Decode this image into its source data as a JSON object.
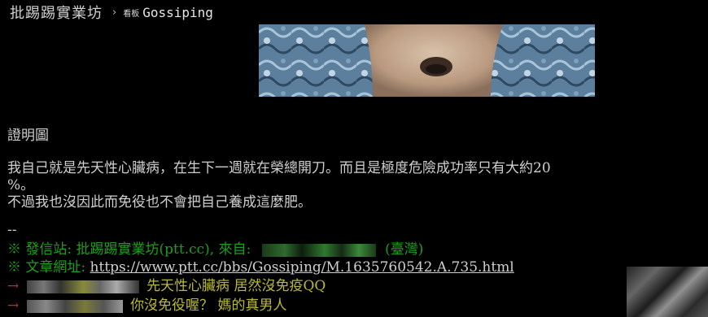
{
  "header": {
    "site_title": "批踢踢實業坊",
    "separator": "›",
    "board_prefix": "看板",
    "board_name": "Gossiping"
  },
  "body": {
    "line1": "證明圖",
    "line2": "我自己就是先天性心臟病，在生下一週就在榮總開刀。而且是極度危險成功率只有大約20",
    "line3": "%。",
    "line4": "不過我也沒因此而免役也不會把自己養成這麼肥。",
    "dash": "--"
  },
  "footer": {
    "site_label": "※ 發信站: 批踢踢實業坊(ptt.cc), 來自:",
    "location": "(臺灣)",
    "url_label": "※ 文章網址:",
    "url": "https://www.ptt.cc/bbs/Gossiping/M.1635760542.A.735.html"
  },
  "comments": [
    {
      "arrow": "→",
      "text": "先天性心臟病 居然沒免疫QQ"
    },
    {
      "arrow": "→",
      "text": "你沒免役喔？ 媽的真男人"
    }
  ]
}
